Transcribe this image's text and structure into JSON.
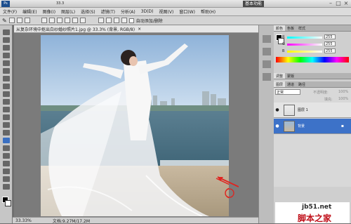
{
  "title": {
    "workspace": "基本功能",
    "zoom": "33.3"
  },
  "menu": [
    "文件(F)",
    "编辑(E)",
    "图像(I)",
    "图层(L)",
    "选择(S)",
    "滤镜(T)",
    "分析(A)",
    "3D(D)",
    "视图(V)",
    "窗口(W)",
    "帮助(H)"
  ],
  "options": {
    "auto_add_delete": "自动添加/删除"
  },
  "document": {
    "tab": "从复杂环境中抠出白纱婚纱照片1.jpg @ 33.3% (背景, RGB/8)",
    "zoom": "33.33%",
    "doc_size": "文档:9.27M/17.2M"
  },
  "color_panel": {
    "tabs": [
      "颜色",
      "色板",
      "样式"
    ],
    "r": "255",
    "g": "255",
    "b": "255",
    "r_label": "R",
    "g_label": "G",
    "b_label": "B"
  },
  "adjust_panel": {
    "tabs": [
      "调整",
      "蒙版"
    ]
  },
  "layers_panel": {
    "tabs": [
      "图层",
      "通道",
      "路径"
    ],
    "blend": "正常",
    "opacity_label": "不透明度:",
    "opacity": "100%",
    "fill_label": "填充:",
    "fill": "100%",
    "layers": [
      {
        "name": "图层 1"
      },
      {
        "name": "背景"
      }
    ]
  },
  "watermark": {
    "site": "jb51.net",
    "brand": "脚本之家"
  }
}
